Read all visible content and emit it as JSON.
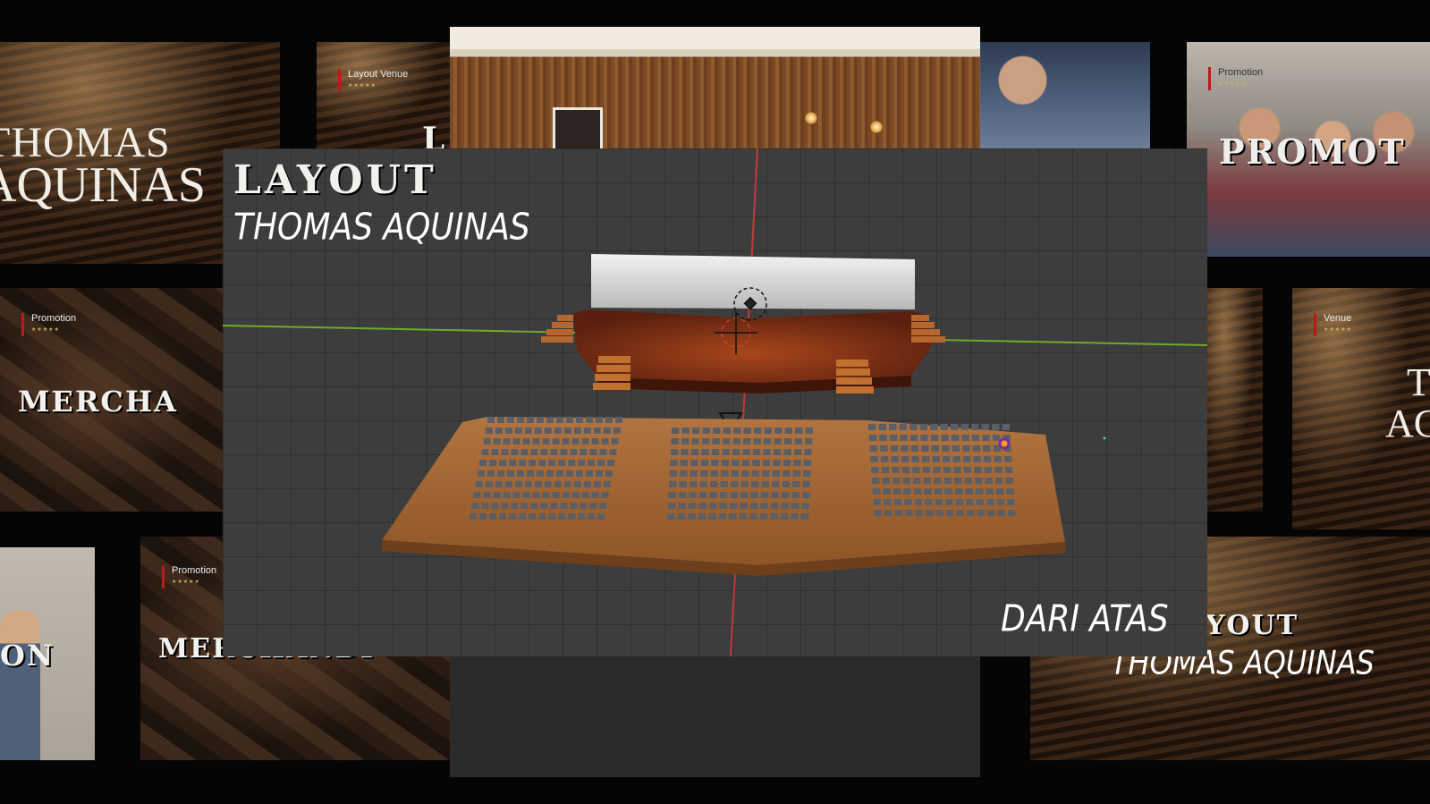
{
  "main_title": "LAYOUT",
  "main_subtitle": "THOMAS AQUINAS",
  "view_caption": "DARI ATAS",
  "bg_tiles": {
    "left_title_line1": "THOMAS",
    "left_title_line2": "AQUINAS",
    "tag_layout_venue": "Layout Venue",
    "tag_promotion_1": "Promotion",
    "tag_promotion_2": "Promotion",
    "tag_promotion_3": "Promotion",
    "tag_venue": "Venue",
    "stars": "★★★★★",
    "merch_1": "MERCHA",
    "merch_2": "MERCHANDI",
    "promot": "PROMOT",
    "on_text": "ON",
    "right_layout": "YOUT",
    "right_subtitle": "THOMAS AQUINAS",
    "partial_l": "L",
    "partial_t": "T",
    "partial_ac": "AC"
  },
  "colors": {
    "viewport_bg": "#3d3d3d",
    "x_axis": "#c23a3a",
    "y_axis": "#6cab2e",
    "seating_floor": "#a86a33",
    "stage": "#6a2612",
    "screen": "#e6e6e6",
    "chairs": "#5c5e66"
  }
}
